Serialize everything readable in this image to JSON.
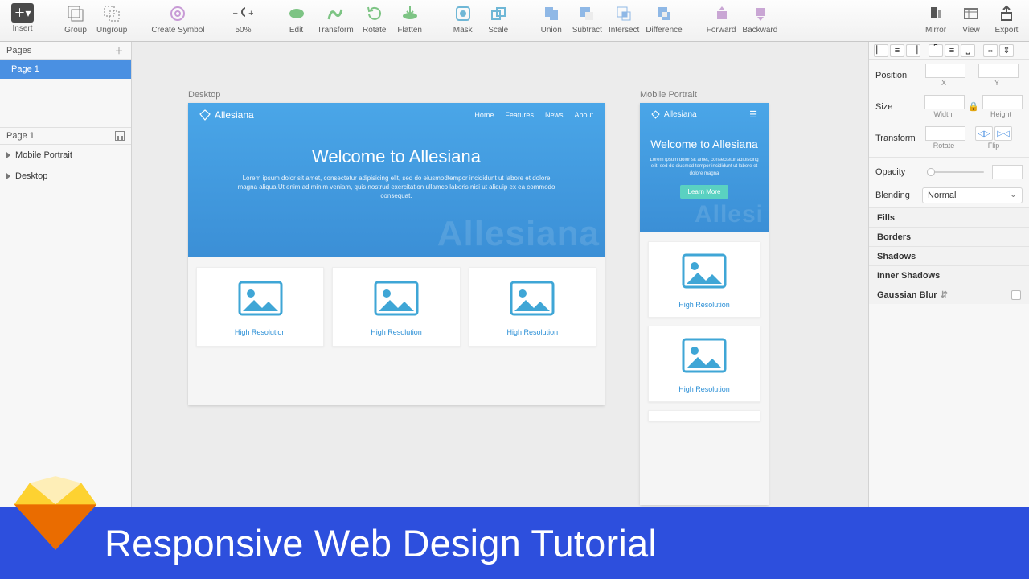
{
  "toolbar": {
    "insert": "Insert",
    "group": "Group",
    "ungroup": "Ungroup",
    "createSymbol": "Create Symbol",
    "zoom": "50%",
    "edit": "Edit",
    "transform": "Transform",
    "rotate": "Rotate",
    "flatten": "Flatten",
    "mask": "Mask",
    "scale": "Scale",
    "union": "Union",
    "subtract": "Subtract",
    "intersect": "Intersect",
    "difference": "Difference",
    "forward": "Forward",
    "backward": "Backward",
    "mirror": "Mirror",
    "view": "View",
    "export": "Export"
  },
  "pages": {
    "title": "Pages",
    "items": [
      "Page 1"
    ],
    "selected": 0
  },
  "layers": {
    "title": "Page 1",
    "items": [
      "Mobile Portrait",
      "Desktop"
    ]
  },
  "canvas": {
    "desktop": {
      "label": "Desktop",
      "brand": "Allesiana",
      "nav": [
        "Home",
        "Features",
        "News",
        "About"
      ],
      "heroTitle": "Welcome to Allesiana",
      "heroText": "Lorem ipsum dolor sit amet, consectetur adipisicing elit, sed do eiusmodtempor incididunt ut labore et dolore magna aliqua.Ut enim ad minim veniam, quis nostrud exercitation ullamco laboris nisi ut aliquip ex ea commodo consequat.",
      "watermark": "Allesiana",
      "cards": [
        "High Resolution",
        "High Resolution",
        "High Resolution"
      ]
    },
    "mobile": {
      "label": "Mobile Portrait",
      "brand": "Allesiana",
      "heroTitle": "Welcome to Allesiana",
      "heroText": "Lorem ipsum dolor sit amet, consectetur adipiscing elit, sed do eiusmod tempor incididunt ut labore et dolore magna",
      "cta": "Learn More",
      "watermark": "Allesi",
      "cards": [
        "High Resolution",
        "High Resolution"
      ]
    }
  },
  "inspector": {
    "position": "Position",
    "x": "X",
    "y": "Y",
    "size": "Size",
    "width": "Width",
    "height": "Height",
    "transform": "Transform",
    "rotate": "Rotate",
    "flip": "Flip",
    "opacity": "Opacity",
    "blending": "Blending",
    "blendValue": "Normal",
    "sections": [
      "Fills",
      "Borders",
      "Shadows",
      "Inner Shadows",
      "Gaussian Blur"
    ]
  },
  "footer": {
    "title": "Responsive Web Design Tutorial"
  }
}
